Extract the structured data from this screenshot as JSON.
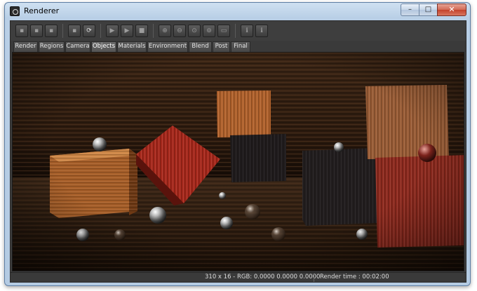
{
  "window": {
    "title": "Renderer",
    "controls": {
      "minimize": "–",
      "maximize": "□",
      "close": "✕"
    }
  },
  "toolbar": {
    "buttons": [
      {
        "name": "open-image-button",
        "icon": "folder-icon",
        "glyph": "▪"
      },
      {
        "name": "save-image-button",
        "icon": "disk-icon",
        "glyph": "▪"
      },
      {
        "name": "copy-image-button",
        "icon": "copy-icon",
        "glyph": "▪"
      },
      {
        "name": "clear-button",
        "icon": "grid-icon",
        "glyph": "▪"
      },
      {
        "name": "refresh-button",
        "icon": "refresh-icon",
        "glyph": "⟳"
      },
      {
        "name": "start-render-button",
        "icon": "play-icon",
        "glyph": "▶"
      },
      {
        "name": "play-region-button",
        "icon": "play-frame-icon",
        "glyph": "▶"
      },
      {
        "name": "stop-render-button",
        "icon": "stop-icon",
        "glyph": "■"
      },
      {
        "name": "zoom-in-button",
        "icon": "magnify-plus-icon",
        "glyph": "⊕"
      },
      {
        "name": "zoom-out-button",
        "icon": "magnify-minus-icon",
        "glyph": "⊖"
      },
      {
        "name": "zoom-fit-button",
        "icon": "magnify-fit-icon",
        "glyph": "⊙"
      },
      {
        "name": "zoom-actual-button",
        "icon": "magnify-one-icon",
        "glyph": "⊚"
      },
      {
        "name": "window-fit-button",
        "icon": "window-icon",
        "glyph": "▭"
      },
      {
        "name": "info-button",
        "icon": "info-icon",
        "glyph": "ℹ"
      },
      {
        "name": "stats-button",
        "icon": "stats-icon",
        "glyph": "ℹ"
      }
    ]
  },
  "tabs": [
    "Render",
    "Regions",
    "Camera",
    "Objects",
    "Materials",
    "Environment",
    "Blend",
    "Post",
    "Final"
  ],
  "active_tab": "Objects",
  "status": {
    "pixel_info": "310 x 16 - RGB: 0.0000  0.0000  0.0000",
    "render_time": "Render time : 00:02:00"
  },
  "colors": {
    "panel": "#3d3d3d",
    "title_gradient": "#b9cfe6",
    "close_button": "#c4422b"
  }
}
